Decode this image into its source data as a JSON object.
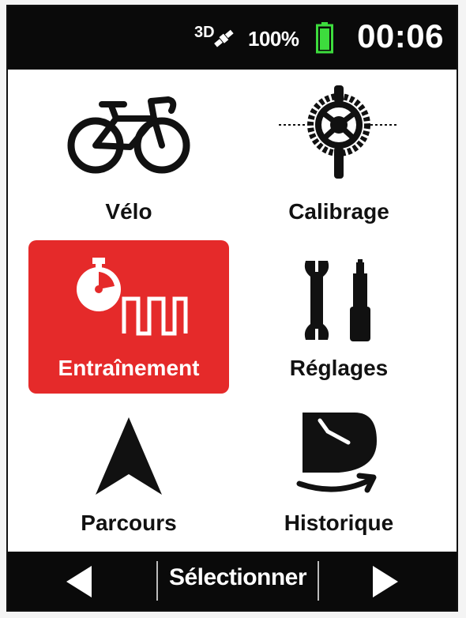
{
  "status_bar": {
    "gps_label": "3D",
    "battery_percent": "100%",
    "time": "00:06"
  },
  "menu": {
    "items": [
      {
        "label": "Vélo",
        "icon": "bicycle-icon"
      },
      {
        "label": "Calibrage",
        "icon": "crankset-icon"
      },
      {
        "label": "Entraînement",
        "icon": "stopwatch-intervals-icon",
        "selected": true
      },
      {
        "label": "Réglages",
        "icon": "wrench-screwdriver-icon"
      },
      {
        "label": "Parcours",
        "icon": "navigation-arrow-icon"
      },
      {
        "label": "Historique",
        "icon": "history-clock-icon"
      }
    ]
  },
  "bottom_bar": {
    "left_icon": "arrow-left-icon",
    "select_label": "Sélectionner",
    "right_icon": "arrow-right-icon"
  },
  "colors": {
    "selected_tile": "#e52a2a",
    "battery_fill": "#3ddc3d",
    "bar_background": "#0a0a0a"
  }
}
